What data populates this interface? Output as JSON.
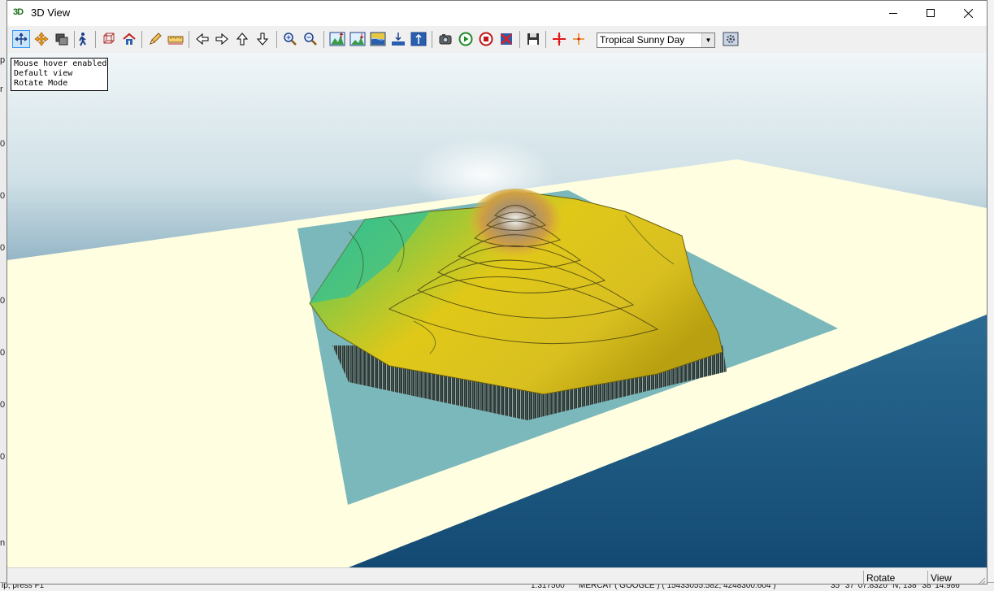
{
  "window": {
    "icon_text": "3D",
    "title": "3D View"
  },
  "window_controls": [
    "minimize",
    "maximize",
    "close"
  ],
  "toolbar": {
    "buttons": [
      {
        "name": "rotate-mode",
        "icon": "move-arrows-icon",
        "active": true
      },
      {
        "name": "pan",
        "icon": "pan-cross-icon"
      },
      {
        "name": "layers",
        "icon": "layers-icon"
      },
      {
        "name": "walk-mode",
        "icon": "walk-person-icon"
      },
      {
        "name": "wireframe",
        "icon": "cube-wire-icon"
      },
      {
        "name": "home-view",
        "icon": "home-icon"
      },
      {
        "name": "draw",
        "icon": "pencil-icon"
      },
      {
        "name": "measure",
        "icon": "ruler-icon"
      },
      {
        "name": "move-left",
        "icon": "arrow-left-icon"
      },
      {
        "name": "move-right",
        "icon": "arrow-right-icon"
      },
      {
        "name": "move-up",
        "icon": "arrow-up-icon"
      },
      {
        "name": "move-down",
        "icon": "arrow-down-icon"
      },
      {
        "name": "zoom-in",
        "icon": "zoom-in-icon"
      },
      {
        "name": "zoom-out",
        "icon": "zoom-out-icon"
      },
      {
        "name": "terrain-exaggerate",
        "icon": "terrain-up-icon"
      },
      {
        "name": "terrain-flatten",
        "icon": "terrain-down-icon"
      },
      {
        "name": "water-level",
        "icon": "water-icon"
      },
      {
        "name": "lower-water",
        "icon": "water-down-icon"
      },
      {
        "name": "raise-water",
        "icon": "water-up-icon"
      },
      {
        "name": "camera-settings",
        "icon": "camera-icon"
      },
      {
        "name": "play-flyover",
        "icon": "play-icon"
      },
      {
        "name": "stop-flyover",
        "icon": "stop-icon"
      },
      {
        "name": "record",
        "icon": "record-icon"
      },
      {
        "name": "save",
        "icon": "floppy-icon"
      },
      {
        "name": "crosshair-red",
        "icon": "crosshair-red-icon"
      },
      {
        "name": "crosshair-orange",
        "icon": "crosshair-orange-icon"
      },
      {
        "name": "sky-settings",
        "icon": "sky-settings-icon"
      }
    ],
    "sky_select": {
      "value": "Tropical Sunny Day"
    }
  },
  "viewport": {
    "info_lines": [
      "Mouse hover enabled",
      "Default view",
      "Rotate Mode"
    ]
  },
  "statusbar": {
    "mode": "Rotate",
    "view": "View"
  },
  "background_app": {
    "left_ticks": [
      "p",
      "r",
      "0",
      "0",
      "0",
      "0",
      "0",
      "0",
      "0",
      "n"
    ],
    "status_left": "lp, press F1",
    "status_scale": "1:317500",
    "status_projection": "MERCAT ( GOOGLE ) ( 15433055.582, 4248300.604 )",
    "status_coords": "35° 37' 07.8320\" N, 138° 38' 14.986"
  },
  "colors": {
    "accent": "#3399ff",
    "sky_top": "#dbe9ef",
    "sea": "#1d5b86",
    "plane": "#fffee0",
    "water_plane": "#7bb8bb"
  }
}
